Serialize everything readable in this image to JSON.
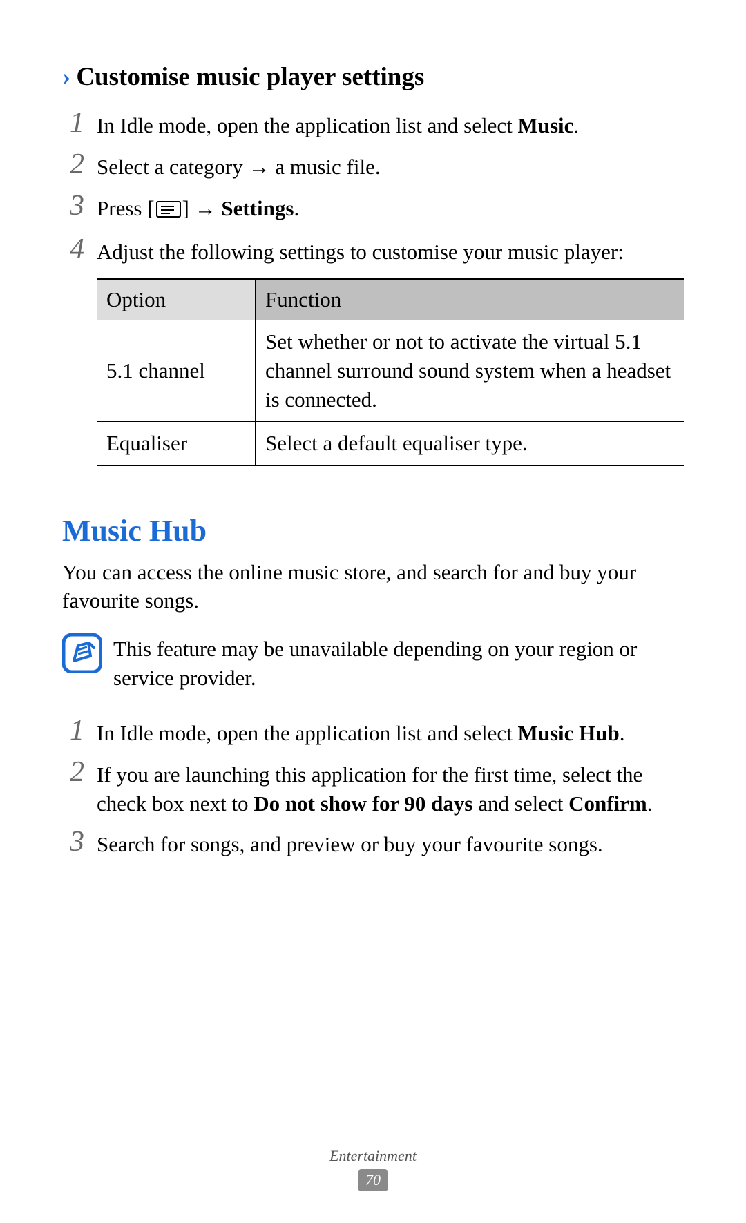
{
  "section1": {
    "heading": "Customise music player settings",
    "steps": {
      "s1": {
        "num": "1",
        "prefix": "In Idle mode, open the application list and select ",
        "bold": "Music",
        "suffix": "."
      },
      "s2": {
        "num": "2",
        "text": "Select a category → a music file."
      },
      "s3": {
        "num": "3",
        "prefix": "Press [",
        "suffix": "] → ",
        "bold": "Settings",
        "end": "."
      },
      "s4": {
        "num": "4",
        "text": "Adjust the following settings to customise your music player:"
      }
    },
    "table": {
      "header": {
        "col1": "Option",
        "col2": "Function"
      },
      "rows": [
        {
          "option": "5.1 channel",
          "function": "Set whether or not to activate the virtual 5.1 channel surround sound system when a headset is connected."
        },
        {
          "option": "Equaliser",
          "function": "Select a default equaliser type."
        }
      ]
    }
  },
  "section2": {
    "heading": "Music Hub",
    "intro": "You can access the online music store, and search for and buy your favourite songs.",
    "note": "This feature may be unavailable depending on your region or service provider.",
    "steps": {
      "s1": {
        "num": "1",
        "prefix": "In Idle mode, open the application list and select ",
        "bold": "Music Hub",
        "suffix": "."
      },
      "s2": {
        "num": "2",
        "prefix": "If you are launching this application for the first time, select the check box next to ",
        "bold1": "Do not show for 90 days",
        "mid": " and select ",
        "bold2": "Confirm",
        "suffix": "."
      },
      "s3": {
        "num": "3",
        "text": "Search for songs, and preview or buy your favourite songs."
      }
    }
  },
  "footer": {
    "category": "Entertainment",
    "page": "70"
  }
}
